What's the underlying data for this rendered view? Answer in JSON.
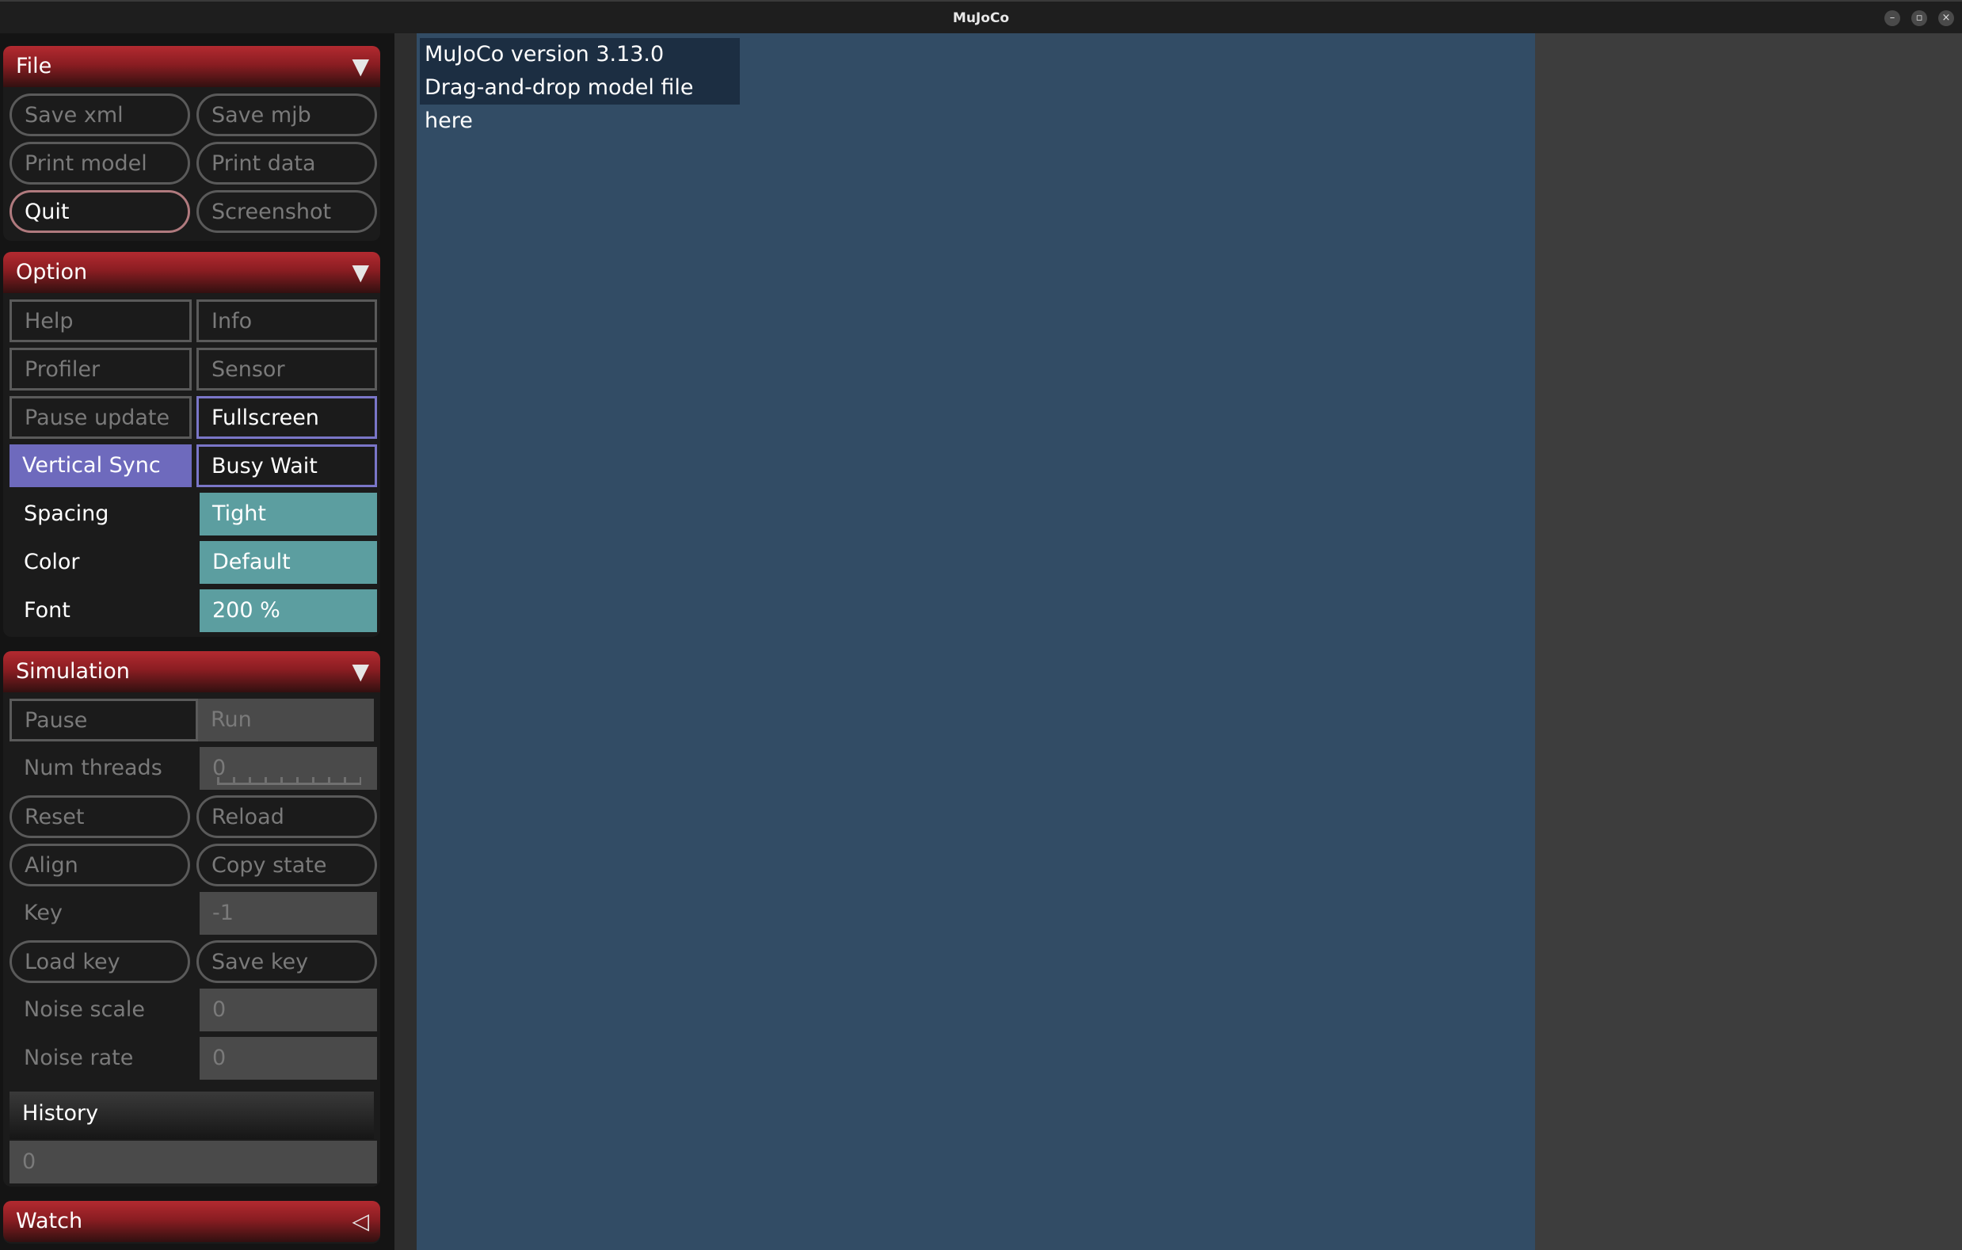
{
  "window": {
    "title": "MuJoCo"
  },
  "info": {
    "line1": "MuJoCo version 3.13.0",
    "line2": "Drag-and-drop model file here"
  },
  "file": {
    "title": "File",
    "save_xml": "Save xml",
    "save_mjb": "Save mjb",
    "print_model": "Print model",
    "print_data": "Print data",
    "quit": "Quit",
    "screenshot": "Screenshot"
  },
  "option": {
    "title": "Option",
    "help": "Help",
    "info": "Info",
    "profiler": "Profiler",
    "sensor": "Sensor",
    "pause_update": "Pause update",
    "fullscreen": "Fullscreen",
    "vertical_sync": "Vertical Sync",
    "busy_wait": "Busy Wait",
    "spacing_label": "Spacing",
    "spacing_value": "Tight",
    "color_label": "Color",
    "color_value": "Default",
    "font_label": "Font",
    "font_value": "200 %"
  },
  "simulation": {
    "title": "Simulation",
    "pause": "Pause",
    "run": "Run",
    "num_threads_label": "Num threads",
    "num_threads_value": "0",
    "reset": "Reset",
    "reload": "Reload",
    "align": "Align",
    "copy_state": "Copy state",
    "key_label": "Key",
    "key_value": "-1",
    "load_key": "Load key",
    "save_key": "Save key",
    "noise_scale_label": "Noise scale",
    "noise_scale_value": "0",
    "noise_rate_label": "Noise rate",
    "noise_rate_value": "0",
    "history_label": "History",
    "history_value": "0"
  },
  "watch": {
    "title": "Watch"
  },
  "colors": {
    "header_red": "#8a1d22",
    "selected_purple": "#6e6abd",
    "teal": "#5c9ea0",
    "viewport": "#324c65"
  },
  "icons": {
    "section_expanded": "triangle-down-icon",
    "section_collapsed": "triangle-left-icon"
  }
}
